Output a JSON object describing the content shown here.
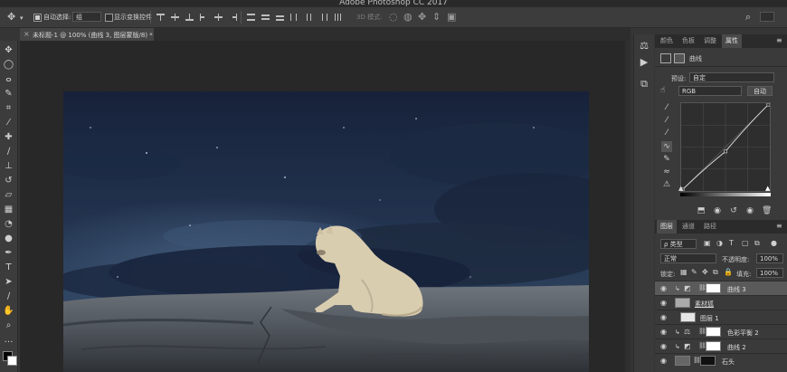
{
  "app": {
    "title": "Adobe Photoshop CC 2017"
  },
  "options_bar": {
    "auto_select_label": "自动选择:",
    "auto_select_value": "组",
    "show_transform_label": "显示变换控件",
    "mode_3d_label": "3D 模式:"
  },
  "document": {
    "tab_label": "未标题-1 @ 100% (曲线 3, 图层蒙版/8) *"
  },
  "properties_panel": {
    "tabs": [
      "颜色",
      "色板",
      "调整",
      "属性"
    ],
    "active_tab": "属性",
    "title": "曲线",
    "preset_label": "预设:",
    "preset_value": "自定",
    "channel_value": "RGB",
    "auto_button": "自动",
    "curve_points": [
      [
        0,
        0
      ],
      [
        0.5,
        0.45
      ],
      [
        1,
        1
      ]
    ]
  },
  "layers_panel": {
    "tabs": [
      "图层",
      "通道",
      "路径"
    ],
    "active_tab": "图层",
    "filter_value": "ρ 类型",
    "blend_mode": "正常",
    "opacity_label": "不透明度:",
    "opacity_value": "100%",
    "lock_label": "锁定:",
    "fill_label": "填充:",
    "fill_value": "100%",
    "layers": [
      {
        "name": "曲线 3",
        "selected": true
      },
      {
        "name": "素材狐",
        "selected": false
      },
      {
        "name": "图层 1",
        "selected": false
      },
      {
        "name": "色彩平衡 2",
        "selected": false
      },
      {
        "name": "曲线 2",
        "selected": false
      },
      {
        "name": "石头",
        "selected": false
      }
    ]
  },
  "colors": {
    "sky_top": "#17223a",
    "sky_bottom": "#2a3d5c",
    "rock": "#5b6168",
    "wolf": "#d9cdb0"
  }
}
